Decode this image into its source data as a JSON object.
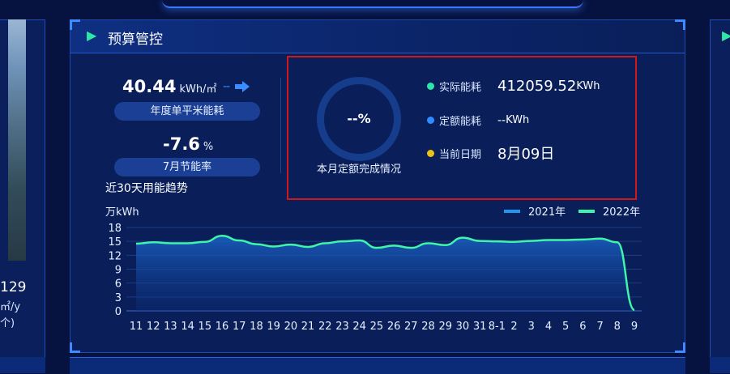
{
  "left_panel": {
    "value": "129",
    "unit": "㎡/y",
    "sub": "个)"
  },
  "panel": {
    "title": "预算管控"
  },
  "stats": {
    "energy_per_sqm": {
      "value": "40.44",
      "unit": "kWh/㎡",
      "trend": "--",
      "label": "年度单平米能耗"
    },
    "saving_rate": {
      "value": "-7.6",
      "unit": "%",
      "label": "7月节能率"
    }
  },
  "quota": {
    "percent": "--%",
    "caption": "本月定额完成情况",
    "actual": {
      "label": "实际能耗",
      "value": "412059.52",
      "unit": "KWh",
      "color": "#2ee6a6"
    },
    "quota": {
      "label": "定额能耗",
      "value": "--",
      "unit": "KWh",
      "color": "#2f8cff"
    },
    "date": {
      "label": "当前日期",
      "value": "8月09日",
      "color": "#e8c21a"
    }
  },
  "trend_title": "近30天用能趋势",
  "chart_data": {
    "type": "area",
    "ylabel": "万kWh",
    "ylim": [
      0,
      18
    ],
    "yticks": [
      0,
      3,
      6,
      9,
      12,
      15,
      18
    ],
    "categories": [
      "11",
      "12",
      "13",
      "14",
      "15",
      "16",
      "17",
      "18",
      "19",
      "20",
      "21",
      "22",
      "23",
      "24",
      "25",
      "26",
      "27",
      "28",
      "29",
      "30",
      "31",
      "8-1",
      "2",
      "3",
      "4",
      "5",
      "6",
      "7",
      "8",
      "9"
    ],
    "series": [
      {
        "name": "2021年",
        "color": "#2196f3",
        "values": []
      },
      {
        "name": "2022年",
        "color": "#3ef5a8",
        "values": [
          14.5,
          14.8,
          14.6,
          14.6,
          14.9,
          16.2,
          15.2,
          14.4,
          13.9,
          14.3,
          13.8,
          14.6,
          15.0,
          15.2,
          13.6,
          14.1,
          13.6,
          14.6,
          14.2,
          15.8,
          15.1,
          15.0,
          14.9,
          15.1,
          15.3,
          15.3,
          15.4,
          15.6,
          14.8,
          0.2
        ]
      }
    ],
    "legend_position": "top-right"
  }
}
